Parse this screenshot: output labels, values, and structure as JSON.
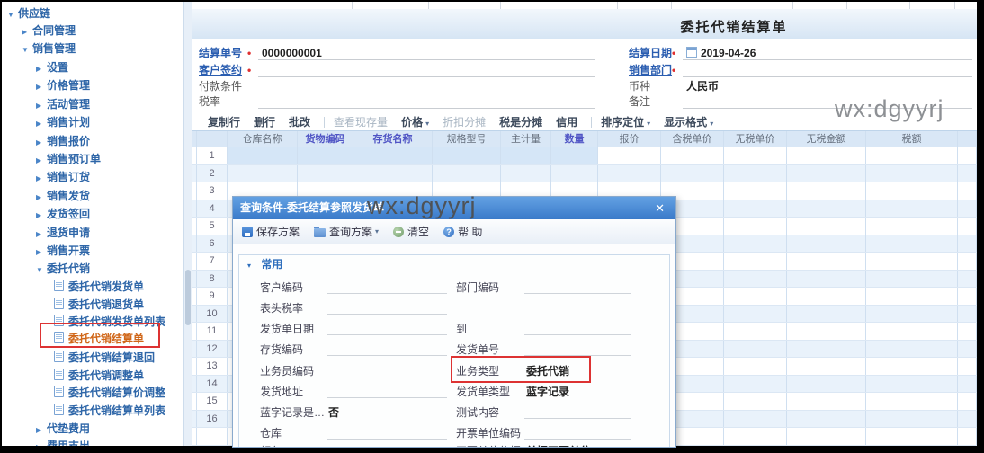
{
  "watermark": {
    "text": "wx:dgyyrj"
  },
  "icons": {
    "tree_expanded": "▼",
    "tree_collapsed": "▶",
    "dropdown": "▾",
    "section_chevron": "▾"
  },
  "sidebar": {
    "items": [
      {
        "label": "供应链",
        "level": 0,
        "kind": "branch",
        "state": "expanded"
      },
      {
        "label": "合同管理",
        "level": 1,
        "kind": "branch",
        "state": "collapsed"
      },
      {
        "label": "销售管理",
        "level": 1,
        "kind": "branch",
        "state": "expanded"
      },
      {
        "label": "设置",
        "level": 2,
        "kind": "branch",
        "state": "collapsed"
      },
      {
        "label": "价格管理",
        "level": 2,
        "kind": "branch",
        "state": "collapsed"
      },
      {
        "label": "活动管理",
        "level": 2,
        "kind": "branch",
        "state": "collapsed"
      },
      {
        "label": "销售计划",
        "level": 2,
        "kind": "branch",
        "state": "collapsed"
      },
      {
        "label": "销售报价",
        "level": 2,
        "kind": "branch",
        "state": "collapsed"
      },
      {
        "label": "销售预订单",
        "level": 2,
        "kind": "branch",
        "state": "collapsed"
      },
      {
        "label": "销售订货",
        "level": 2,
        "kind": "branch",
        "state": "collapsed"
      },
      {
        "label": "销售发货",
        "level": 2,
        "kind": "branch",
        "state": "collapsed"
      },
      {
        "label": "发货签回",
        "level": 2,
        "kind": "branch",
        "state": "collapsed"
      },
      {
        "label": "退货申请",
        "level": 2,
        "kind": "branch",
        "state": "collapsed"
      },
      {
        "label": "销售开票",
        "level": 2,
        "kind": "branch",
        "state": "collapsed"
      },
      {
        "label": "委托代销",
        "level": 2,
        "kind": "branch",
        "state": "expanded"
      },
      {
        "label": "委托代销发货单",
        "level": 3,
        "kind": "doc"
      },
      {
        "label": "委托代销退货单",
        "level": 3,
        "kind": "doc"
      },
      {
        "label": "委托代销发货单列表",
        "level": 3,
        "kind": "doc"
      },
      {
        "label": "委托代销结算单",
        "level": 3,
        "kind": "doc",
        "selected": true
      },
      {
        "label": "委托代销结算退回",
        "level": 3,
        "kind": "doc"
      },
      {
        "label": "委托代销调整单",
        "level": 3,
        "kind": "doc"
      },
      {
        "label": "委托代销结算价调整",
        "level": 3,
        "kind": "doc"
      },
      {
        "label": "委托代销结算单列表",
        "level": 3,
        "kind": "doc"
      },
      {
        "label": "代垫费用",
        "level": 2,
        "kind": "branch",
        "state": "collapsed"
      },
      {
        "label": "费用支出",
        "level": 2,
        "kind": "branch",
        "state": "collapsed"
      }
    ]
  },
  "header": {
    "title": "委托代销结算单"
  },
  "form": {
    "left": [
      {
        "label": "结算单号",
        "required": true,
        "value": "0000000001",
        "link": false,
        "date": false
      },
      {
        "label": "客户签约",
        "required": true,
        "value": "",
        "link": true,
        "date": false
      },
      {
        "label": "付款条件",
        "required": false,
        "value": "",
        "link": false,
        "date": false
      },
      {
        "label": "税率",
        "required": false,
        "value": "",
        "link": false,
        "date": false
      }
    ],
    "right": [
      {
        "label": "结算日期",
        "required": true,
        "value": "2019-04-26",
        "link": false,
        "date": true
      },
      {
        "label": "销售部门",
        "required": true,
        "value": "",
        "link": true,
        "date": false
      },
      {
        "label": "币种",
        "required": false,
        "value": "人民币",
        "link": false,
        "date": false
      },
      {
        "label": "备注",
        "required": false,
        "value": "",
        "link": false,
        "date": false
      }
    ]
  },
  "toolbar": {
    "buttons": [
      {
        "label": "复制行"
      },
      {
        "label": "删行"
      },
      {
        "label": "批改"
      },
      {
        "sep": true
      },
      {
        "label": "查看现存量",
        "disabled": true
      },
      {
        "label": "价格",
        "dropdown": true
      },
      {
        "label": "折扣分摊",
        "disabled": true
      },
      {
        "label": "税是分摊"
      },
      {
        "label": "信用"
      },
      {
        "sep": true
      },
      {
        "label": "排序定位",
        "dropdown": true
      },
      {
        "label": "显示格式",
        "dropdown": true
      }
    ]
  },
  "grid": {
    "columns": [
      {
        "label": "仓库名称",
        "em": false
      },
      {
        "label": "货物编码",
        "em": true
      },
      {
        "label": "存货名称",
        "em": true
      },
      {
        "label": "规格型号",
        "em": false
      },
      {
        "label": "主计量",
        "em": false
      },
      {
        "label": "数量",
        "em": true
      },
      {
        "label": "报价",
        "em": false
      },
      {
        "label": "含税单价",
        "em": false
      },
      {
        "label": "无税单价",
        "em": false
      },
      {
        "label": "无税金额",
        "em": false
      },
      {
        "label": "税额",
        "em": false
      },
      {
        "label": "",
        "em": false
      }
    ],
    "row_numbers": [
      "1",
      "2",
      "3",
      "4",
      "5",
      "6",
      "7",
      "8",
      "9",
      "10",
      "11",
      "12",
      "13",
      "14",
      "15",
      "16",
      ""
    ]
  },
  "dialog": {
    "title": "查询条件-委托结算参照发货单",
    "close": "✕",
    "toolbar": [
      {
        "label": "保存方案",
        "icon": "save"
      },
      {
        "label": "查询方案",
        "icon": "folder",
        "dropdown": true
      },
      {
        "label": "清空",
        "icon": "clear"
      },
      {
        "label": "帮 助",
        "icon": "help"
      }
    ],
    "section": "常用",
    "rows": [
      {
        "l": "客户编码",
        "lv": "",
        "lline": true,
        "r": "部门编码",
        "rv": "",
        "rline": true
      },
      {
        "l": "表头税率",
        "lv": "",
        "lline": true,
        "r": "",
        "rv": "",
        "rline": false
      },
      {
        "l": "发货单日期",
        "lv": "",
        "lline": true,
        "r": "到",
        "rv": "",
        "rline": true
      },
      {
        "l": "存货编码",
        "lv": "",
        "lline": true,
        "r": "发货单号",
        "rv": "",
        "rline": true
      },
      {
        "l": "业务员编码",
        "lv": "",
        "lline": true,
        "r": "业务类型",
        "rv": "委托代销",
        "rline": false,
        "highlight": true
      },
      {
        "l": "发货地址",
        "lv": "",
        "lline": true,
        "r": "发货单类型",
        "rv": "蓝字记录",
        "rline": false
      },
      {
        "l": "蓝字记录是…",
        "lv": "否",
        "lline": false,
        "r": "测试内容",
        "rv": "",
        "rline": true
      },
      {
        "l": "仓库",
        "lv": "",
        "lline": true,
        "r": "开票单位编码",
        "rv": "",
        "rline": true
      },
      {
        "l": "颜色",
        "lv": "",
        "lline": true,
        "r": "开票单位依据",
        "rv": "单据开票单位",
        "rline": false
      }
    ]
  }
}
